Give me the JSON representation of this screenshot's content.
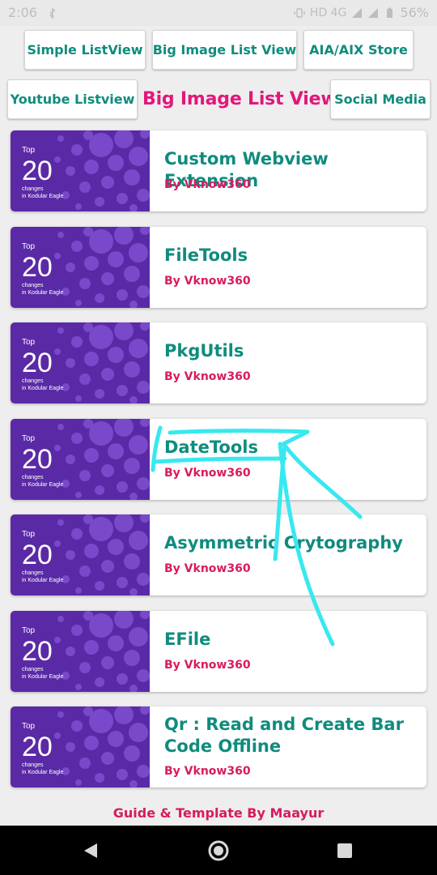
{
  "status": {
    "time": "2:06",
    "network": "HD 4G",
    "battery": "56%"
  },
  "buttons": {
    "simple_listview": "Simple ListView",
    "big_image_list_view": "Big Image List View",
    "aia_aix_store": "AIA/AIX Store",
    "youtube_listview": "Youtube Listview",
    "social_media": "Social Media"
  },
  "page_heading": "Big Image List View",
  "thumbnail": {
    "top": "Top",
    "number": "20",
    "line1": "changes",
    "line2": "in Kodular Eagle"
  },
  "items": [
    {
      "title": "Custom Webview Extension",
      "subtitle": "By Vknow360"
    },
    {
      "title": "FileTools",
      "subtitle": "By Vknow360"
    },
    {
      "title": "PkgUtils",
      "subtitle": "By Vknow360"
    },
    {
      "title": "DateTools",
      "subtitle": "By Vknow360"
    },
    {
      "title": "Asymmetric Crytography",
      "subtitle": "By Vknow360"
    },
    {
      "title": "EFile",
      "subtitle": "By Vknow360"
    },
    {
      "title": "Qr : Read and Create Bar Code Offline",
      "subtitle": "By Vknow360"
    }
  ],
  "footer": "Guide & Template By Maayur",
  "colors": {
    "title_teal": "#0f8c7d",
    "accent_pink": "#d81b60",
    "thumb_purple": "#5a2aa6",
    "annotation_cyan": "#38e8f0"
  },
  "icons": [
    "usb-icon",
    "vibrate-icon",
    "signal-icon",
    "battery-icon",
    "back-icon",
    "home-icon",
    "recents-icon",
    "arrow-annotation"
  ]
}
